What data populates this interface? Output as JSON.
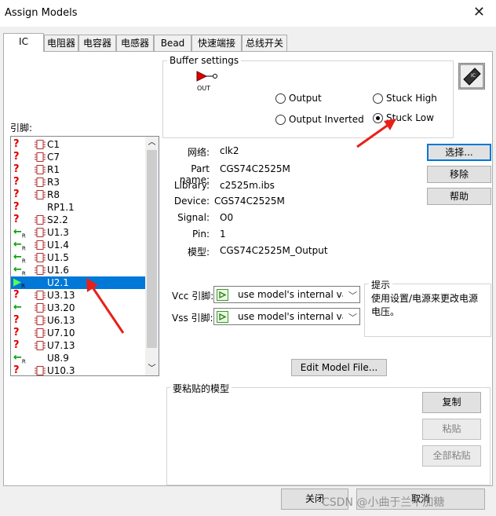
{
  "window": {
    "title": "Assign Models",
    "close_glyph": "✕"
  },
  "tabs": [
    {
      "label": "IC"
    },
    {
      "label": "电阻器"
    },
    {
      "label": "电容器"
    },
    {
      "label": "电感器"
    },
    {
      "label": "Bead"
    },
    {
      "label": "快速端接"
    },
    {
      "label": "总线开关"
    }
  ],
  "buffer": {
    "group_label": "Buffer settings",
    "symbol_label": "OUT",
    "options": [
      {
        "label": "Output",
        "checked": false
      },
      {
        "label": "Output Inverted",
        "checked": false
      },
      {
        "label": "Stuck High",
        "checked": false
      },
      {
        "label": "Stuck Low",
        "checked": true
      }
    ]
  },
  "pins_label": "引脚:",
  "pins": [
    {
      "status": "?",
      "comp": true,
      "name": "C1",
      "selected": false
    },
    {
      "status": "?",
      "comp": true,
      "name": "C7",
      "selected": false
    },
    {
      "status": "?",
      "comp": true,
      "name": "R1",
      "selected": false
    },
    {
      "status": "?",
      "comp": true,
      "name": "R3",
      "selected": false
    },
    {
      "status": "?",
      "comp": true,
      "name": "R8",
      "selected": false
    },
    {
      "status": "?",
      "comp": false,
      "name": "RP1.1",
      "selected": false
    },
    {
      "status": "?",
      "comp": true,
      "name": "S2.2",
      "selected": false
    },
    {
      "status": "←R",
      "comp": true,
      "name": "U1.3",
      "selected": false
    },
    {
      "status": "←R",
      "comp": true,
      "name": "U1.4",
      "selected": false
    },
    {
      "status": "←R",
      "comp": true,
      "name": "U1.5",
      "selected": false
    },
    {
      "status": "←R",
      "comp": true,
      "name": "U1.6",
      "selected": false
    },
    {
      "status": "▶R",
      "comp": false,
      "name": "U2.1",
      "selected": true
    },
    {
      "status": "?",
      "comp": true,
      "name": "U3.13",
      "selected": false
    },
    {
      "status": "←",
      "comp": true,
      "name": "U3.20",
      "selected": false
    },
    {
      "status": "?",
      "comp": true,
      "name": "U6.13",
      "selected": false
    },
    {
      "status": "?",
      "comp": true,
      "name": "U7.10",
      "selected": false
    },
    {
      "status": "?",
      "comp": true,
      "name": "U7.13",
      "selected": false
    },
    {
      "status": "←R",
      "comp": false,
      "name": "U8.9",
      "selected": false
    },
    {
      "status": "?",
      "comp": true,
      "name": "U10.3",
      "selected": false
    }
  ],
  "details": {
    "net_label": "网络:",
    "net": "clk2",
    "part_label": "Part name:",
    "part": "CGS74C2525M",
    "library_label": "Library:",
    "library": "c2525m.ibs",
    "device_label": "Device:",
    "device": "CGS74C2525M",
    "signal_label": "Signal:",
    "signal": "O0",
    "pin_label": "Pin:",
    "pin": "1",
    "model_label": "模型:",
    "model": "CGS74C2525M_Output"
  },
  "side_buttons": {
    "select": "选择...",
    "remove": "移除",
    "help": "帮助"
  },
  "vcc": {
    "label": "Vcc 引脚:",
    "value": "use model's internal va"
  },
  "vss": {
    "label": "Vss 引脚:",
    "value": "use model's internal va"
  },
  "hint": {
    "title": "提示",
    "text": "使用设置/电源来更改电源电压。"
  },
  "edit_model_button": "Edit Model File...",
  "paste": {
    "group_label": "要粘贴的模型",
    "copy": "复制",
    "paste": "粘贴",
    "paste_all": "全部粘贴"
  },
  "footer": {
    "close": "关闭",
    "cancel": "取消"
  },
  "watermark": "CSDN @小曲于兰不加糖"
}
